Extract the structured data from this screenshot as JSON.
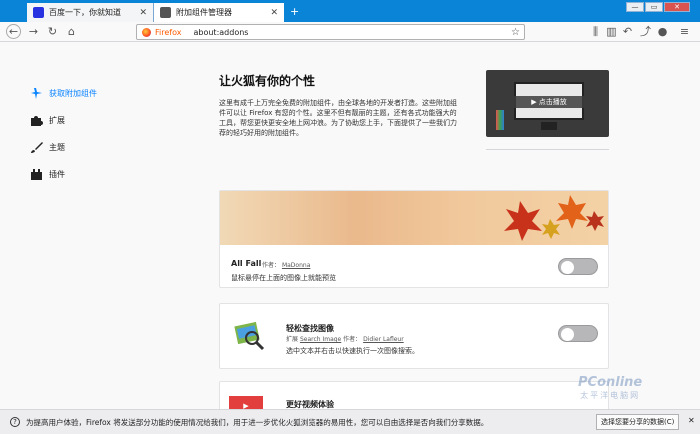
{
  "window": {
    "tabs": [
      {
        "label": "百度一下，你就知道",
        "close": "✕"
      },
      {
        "label": "附加组件管理器",
        "close": "✕"
      }
    ],
    "controls": {
      "minimize": "—",
      "maximize": "▭",
      "close": "✕"
    }
  },
  "toolbar": {
    "identity_label": "Firefox",
    "url": "about:addons"
  },
  "sidebar": {
    "items": [
      {
        "label": "获取附加组件"
      },
      {
        "label": "扩展"
      },
      {
        "label": "主题"
      },
      {
        "label": "插件"
      }
    ]
  },
  "main": {
    "heading": "让火狐有你的个性",
    "intro": "这里有成千上万完全免费的附加组件，由全球各地的开发者打造。这些附加组件可以让 Firefox 有您的个性。这里不但有靓丽的主题，还有各式功能强大的工具，帮您更快更安全地上网冲浪。为了协助您上手，下面提供了一些我们力荐的轻巧好用的附加组件。",
    "video_label": "▶ 点击播放",
    "cards": [
      {
        "title": "All Fall",
        "author_prefix": "作者：",
        "author": "MaDonna",
        "desc": "鼠标悬停在上面的图像上就能预览"
      },
      {
        "title": "轻松查找图像",
        "ext_prefix": "扩展",
        "ext_name": "Search Image",
        "author_prefix": "作者：",
        "author": "Didier Lafleur",
        "desc": "选中文本并右击以快速执行一次图像搜索。"
      },
      {
        "title": "更好视频体验"
      }
    ]
  },
  "notification": {
    "text": "为提高用户体验，Firefox 将发送部分功能的使用情况给我们，用于进一步优化火狐浏览器的易用性，您可以自由选择是否向我们分享数据。",
    "button": "选择您要分享的数据(C)",
    "close": "✕"
  },
  "watermark": {
    "brand": "PConline",
    "subtitle": "太平洋电脑网"
  },
  "colors": {
    "accent": "#0a84d6",
    "link_blue": "#0a84ff",
    "sidebar_active": "#0a84ff"
  }
}
